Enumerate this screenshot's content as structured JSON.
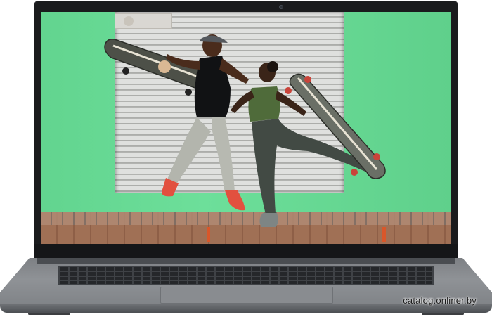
{
  "photo": {
    "subject": "two skateboarders jumping",
    "wall_color": "#66dc96",
    "shutter_color": "#dfe0de",
    "pavement_color": "#a07055",
    "laptop_color": "#8f9296"
  },
  "watermark": {
    "text": "catalog.onliner.by"
  }
}
